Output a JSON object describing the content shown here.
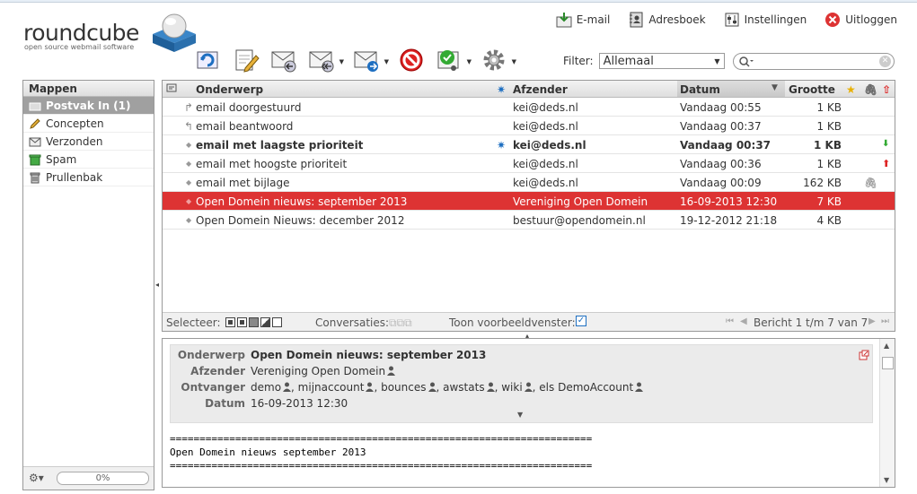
{
  "app": {
    "logo_text": "roundcube",
    "tagline": "open source webmail software"
  },
  "topnav": [
    {
      "label": "E-mail",
      "icon": "mail-download-icon"
    },
    {
      "label": "Adresboek",
      "icon": "address-book-icon"
    },
    {
      "label": "Instellingen",
      "icon": "settings-icon"
    },
    {
      "label": "Uitloggen",
      "icon": "logout-icon"
    }
  ],
  "filter": {
    "label": "Filter:",
    "value": "Allemaal"
  },
  "folders": {
    "title": "Mappen",
    "items": [
      {
        "label": "Postvak In (1)",
        "icon": "inbox-icon",
        "selected": true
      },
      {
        "label": "Concepten",
        "icon": "pencil-icon"
      },
      {
        "label": "Verzonden",
        "icon": "sent-icon"
      },
      {
        "label": "Spam",
        "icon": "spam-icon"
      },
      {
        "label": "Prullenbak",
        "icon": "trash-icon"
      }
    ],
    "quota": "0%"
  },
  "list": {
    "columns": {
      "subject": "Onderwerp",
      "from": "Afzender",
      "date": "Datum",
      "size": "Grootte"
    },
    "rows": [
      {
        "subject": "email doorgestuurd",
        "from": "kei@deds.nl",
        "date": "Vandaag 00:55",
        "size": "1 KB",
        "status": "forwarded"
      },
      {
        "subject": "email beantwoord",
        "from": "kei@deds.nl",
        "date": "Vandaag 00:37",
        "size": "1 KB",
        "status": "replied"
      },
      {
        "subject": "email met laagste prioriteit",
        "from": "kei@deds.nl",
        "date": "Vandaag 00:37",
        "size": "1 KB",
        "status": "unread",
        "priority": "low"
      },
      {
        "subject": "email met hoogste prioriteit",
        "from": "kei@deds.nl",
        "date": "Vandaag 00:36",
        "size": "1 KB",
        "priority": "high"
      },
      {
        "subject": "email met bijlage",
        "from": "kei@deds.nl",
        "date": "Vandaag 00:09",
        "size": "162 KB",
        "attachment": true
      },
      {
        "subject": "Open Domein nieuws: september 2013",
        "from": "Vereniging Open Domein",
        "date": "16-09-2013 12:30",
        "size": "7 KB",
        "selected": true
      },
      {
        "subject": "Open Domein Nieuws: december 2012",
        "from": "bestuur@opendomein.nl",
        "date": "19-12-2012 21:18",
        "size": "4 KB"
      }
    ],
    "footer": {
      "select": "Selecteer:",
      "threads": "Conversaties:",
      "preview": "Toon voorbeeldvenster:",
      "count": "Bericht 1 t/m 7 van 7"
    }
  },
  "preview": {
    "subject_label": "Onderwerp",
    "subject": "Open Domein nieuws: september 2013",
    "from_label": "Afzender",
    "from": "Vereniging Open Domein",
    "to_label": "Ontvanger",
    "to": [
      "demo",
      "mijnaccount",
      "bounces",
      "awstats",
      "wiki",
      "els DemoAccount"
    ],
    "date_label": "Datum",
    "date": "16-09-2013 12:30",
    "body_line1": "=======================================================================",
    "body_line2": "Open Domein nieuws september 2013",
    "body_line3": "======================================================================="
  }
}
